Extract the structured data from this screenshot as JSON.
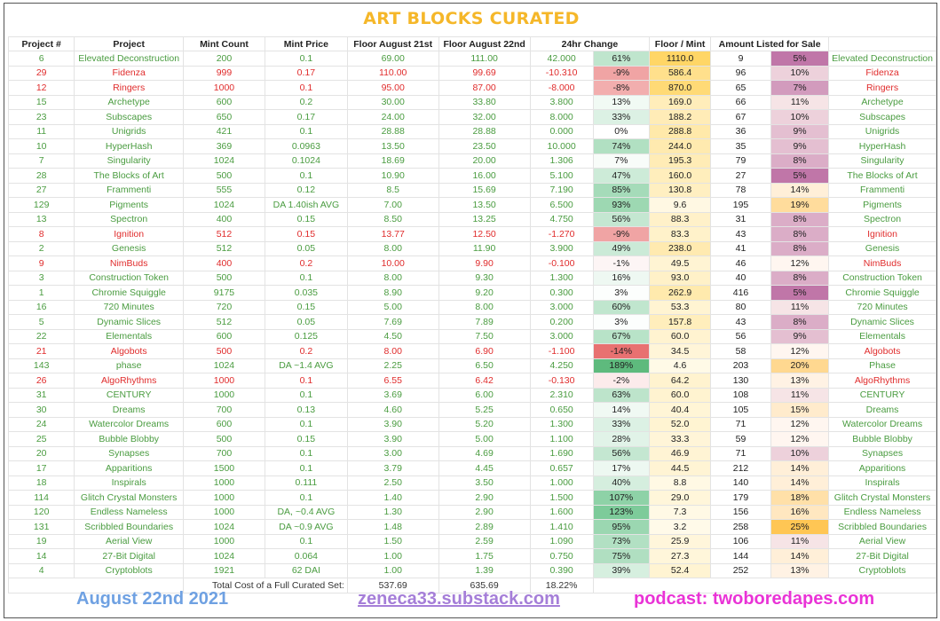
{
  "title": "ART BLOCKS CURATED",
  "headers": [
    "Project #",
    "Project",
    "Mint Count",
    "Mint Price",
    "Floor August 21st",
    "Floor August 22nd",
    "24hr Change",
    "",
    "Floor / Mint",
    "Amount Listed for Sale",
    "",
    ""
  ],
  "rows": [
    {
      "n": "6",
      "p": "Elevated Deconstruction",
      "mc": "200",
      "mp": "0.1",
      "f21": "69.00",
      "f22": "111.00",
      "chg": "42.000",
      "pct": "61%",
      "ratio": "1110.0",
      "listed": "9",
      "listp": "5%",
      "name2": "Elevated Deconstruction",
      "neg": false
    },
    {
      "n": "29",
      "p": "Fidenza",
      "mc": "999",
      "mp": "0.17",
      "f21": "110.00",
      "f22": "99.69",
      "chg": "-10.310",
      "pct": "-9%",
      "ratio": "586.4",
      "listed": "96",
      "listp": "10%",
      "name2": "Fidenza",
      "neg": true
    },
    {
      "n": "12",
      "p": "Ringers",
      "mc": "1000",
      "mp": "0.1",
      "f21": "95.00",
      "f22": "87.00",
      "chg": "-8.000",
      "pct": "-8%",
      "ratio": "870.0",
      "listed": "65",
      "listp": "7%",
      "name2": "Ringers",
      "neg": true
    },
    {
      "n": "15",
      "p": "Archetype",
      "mc": "600",
      "mp": "0.2",
      "f21": "30.00",
      "f22": "33.80",
      "chg": "3.800",
      "pct": "13%",
      "ratio": "169.0",
      "listed": "66",
      "listp": "11%",
      "name2": "Archetype",
      "neg": false
    },
    {
      "n": "23",
      "p": "Subscapes",
      "mc": "650",
      "mp": "0.17",
      "f21": "24.00",
      "f22": "32.00",
      "chg": "8.000",
      "pct": "33%",
      "ratio": "188.2",
      "listed": "67",
      "listp": "10%",
      "name2": "Subscapes",
      "neg": false
    },
    {
      "n": "11",
      "p": "Unigrids",
      "mc": "421",
      "mp": "0.1",
      "f21": "28.88",
      "f22": "28.88",
      "chg": "0.000",
      "pct": "0%",
      "ratio": "288.8",
      "listed": "36",
      "listp": "9%",
      "name2": "Unigrids",
      "neg": false
    },
    {
      "n": "10",
      "p": "HyperHash",
      "mc": "369",
      "mp": "0.0963",
      "f21": "13.50",
      "f22": "23.50",
      "chg": "10.000",
      "pct": "74%",
      "ratio": "244.0",
      "listed": "35",
      "listp": "9%",
      "name2": "HyperHash",
      "neg": false
    },
    {
      "n": "7",
      "p": "Singularity",
      "mc": "1024",
      "mp": "0.1024",
      "f21": "18.69",
      "f22": "20.00",
      "chg": "1.306",
      "pct": "7%",
      "ratio": "195.3",
      "listed": "79",
      "listp": "8%",
      "name2": "Singularity",
      "neg": false
    },
    {
      "n": "28",
      "p": "The Blocks of Art",
      "mc": "500",
      "mp": "0.1",
      "f21": "10.90",
      "f22": "16.00",
      "chg": "5.100",
      "pct": "47%",
      "ratio": "160.0",
      "listed": "27",
      "listp": "5%",
      "name2": "The Blocks of Art",
      "neg": false
    },
    {
      "n": "27",
      "p": "Frammenti",
      "mc": "555",
      "mp": "0.12",
      "f21": "8.5",
      "f22": "15.69",
      "chg": "7.190",
      "pct": "85%",
      "ratio": "130.8",
      "listed": "78",
      "listp": "14%",
      "name2": "Frammenti",
      "neg": false
    },
    {
      "n": "129",
      "p": "Pigments",
      "mc": "1024",
      "mp": "DA 1.40ish AVG",
      "f21": "7.00",
      "f22": "13.50",
      "chg": "6.500",
      "pct": "93%",
      "ratio": "9.6",
      "listed": "195",
      "listp": "19%",
      "name2": "Pigments",
      "neg": false
    },
    {
      "n": "13",
      "p": "Spectron",
      "mc": "400",
      "mp": "0.15",
      "f21": "8.50",
      "f22": "13.25",
      "chg": "4.750",
      "pct": "56%",
      "ratio": "88.3",
      "listed": "31",
      "listp": "8%",
      "name2": "Spectron",
      "neg": false
    },
    {
      "n": "8",
      "p": "Ignition",
      "mc": "512",
      "mp": "0.15",
      "f21": "13.77",
      "f22": "12.50",
      "chg": "-1.270",
      "pct": "-9%",
      "ratio": "83.3",
      "listed": "43",
      "listp": "8%",
      "name2": "Ignition",
      "neg": true
    },
    {
      "n": "2",
      "p": "Genesis",
      "mc": "512",
      "mp": "0.05",
      "f21": "8.00",
      "f22": "11.90",
      "chg": "3.900",
      "pct": "49%",
      "ratio": "238.0",
      "listed": "41",
      "listp": "8%",
      "name2": "Genesis",
      "neg": false
    },
    {
      "n": "9",
      "p": "NimBuds",
      "mc": "400",
      "mp": "0.2",
      "f21": "10.00",
      "f22": "9.90",
      "chg": "-0.100",
      "pct": "-1%",
      "ratio": "49.5",
      "listed": "46",
      "listp": "12%",
      "name2": "NimBuds",
      "neg": true
    },
    {
      "n": "3",
      "p": "Construction Token",
      "mc": "500",
      "mp": "0.1",
      "f21": "8.00",
      "f22": "9.30",
      "chg": "1.300",
      "pct": "16%",
      "ratio": "93.0",
      "listed": "40",
      "listp": "8%",
      "name2": "Construction Token",
      "neg": false
    },
    {
      "n": "1",
      "p": "Chromie Squiggle",
      "mc": "9175",
      "mp": "0.035",
      "f21": "8.90",
      "f22": "9.20",
      "chg": "0.300",
      "pct": "3%",
      "ratio": "262.9",
      "listed": "416",
      "listp": "5%",
      "name2": "Chromie Squiggle",
      "neg": false
    },
    {
      "n": "16",
      "p": "720 Minutes",
      "mc": "720",
      "mp": "0.15",
      "f21": "5.00",
      "f22": "8.00",
      "chg": "3.000",
      "pct": "60%",
      "ratio": "53.3",
      "listed": "80",
      "listp": "11%",
      "name2": "720 Minutes",
      "neg": false
    },
    {
      "n": "5",
      "p": "Dynamic Slices",
      "mc": "512",
      "mp": "0.05",
      "f21": "7.69",
      "f22": "7.89",
      "chg": "0.200",
      "pct": "3%",
      "ratio": "157.8",
      "listed": "43",
      "listp": "8%",
      "name2": "Dynamic Slices",
      "neg": false
    },
    {
      "n": "22",
      "p": "Elementals",
      "mc": "600",
      "mp": "0.125",
      "f21": "4.50",
      "f22": "7.50",
      "chg": "3.000",
      "pct": "67%",
      "ratio": "60.0",
      "listed": "56",
      "listp": "9%",
      "name2": "Elementals",
      "neg": false
    },
    {
      "n": "21",
      "p": "Algobots",
      "mc": "500",
      "mp": "0.2",
      "f21": "8.00",
      "f22": "6.90",
      "chg": "-1.100",
      "pct": "-14%",
      "ratio": "34.5",
      "listed": "58",
      "listp": "12%",
      "name2": "Algobots",
      "neg": true
    },
    {
      "n": "143",
      "p": "phase",
      "mc": "1024",
      "mp": "DA ~1.4 AVG",
      "f21": "2.25",
      "f22": "6.50",
      "chg": "4.250",
      "pct": "189%",
      "ratio": "4.6",
      "listed": "203",
      "listp": "20%",
      "name2": "Phase",
      "neg": false
    },
    {
      "n": "26",
      "p": "AlgoRhythms",
      "mc": "1000",
      "mp": "0.1",
      "f21": "6.55",
      "f22": "6.42",
      "chg": "-0.130",
      "pct": "-2%",
      "ratio": "64.2",
      "listed": "130",
      "listp": "13%",
      "name2": "AlgoRhythms",
      "neg": true
    },
    {
      "n": "31",
      "p": "CENTURY",
      "mc": "1000",
      "mp": "0.1",
      "f21": "3.69",
      "f22": "6.00",
      "chg": "2.310",
      "pct": "63%",
      "ratio": "60.0",
      "listed": "108",
      "listp": "11%",
      "name2": "CENTURY",
      "neg": false
    },
    {
      "n": "30",
      "p": "Dreams",
      "mc": "700",
      "mp": "0.13",
      "f21": "4.60",
      "f22": "5.25",
      "chg": "0.650",
      "pct": "14%",
      "ratio": "40.4",
      "listed": "105",
      "listp": "15%",
      "name2": "Dreams",
      "neg": false
    },
    {
      "n": "24",
      "p": "Watercolor Dreams",
      "mc": "600",
      "mp": "0.1",
      "f21": "3.90",
      "f22": "5.20",
      "chg": "1.300",
      "pct": "33%",
      "ratio": "52.0",
      "listed": "71",
      "listp": "12%",
      "name2": "Watercolor Dreams",
      "neg": false
    },
    {
      "n": "25",
      "p": "Bubble Blobby",
      "mc": "500",
      "mp": "0.15",
      "f21": "3.90",
      "f22": "5.00",
      "chg": "1.100",
      "pct": "28%",
      "ratio": "33.3",
      "listed": "59",
      "listp": "12%",
      "name2": "Bubble Blobby",
      "neg": false
    },
    {
      "n": "20",
      "p": "Synapses",
      "mc": "700",
      "mp": "0.1",
      "f21": "3.00",
      "f22": "4.69",
      "chg": "1.690",
      "pct": "56%",
      "ratio": "46.9",
      "listed": "71",
      "listp": "10%",
      "name2": "Synapses",
      "neg": false
    },
    {
      "n": "17",
      "p": "Apparitions",
      "mc": "1500",
      "mp": "0.1",
      "f21": "3.79",
      "f22": "4.45",
      "chg": "0.657",
      "pct": "17%",
      "ratio": "44.5",
      "listed": "212",
      "listp": "14%",
      "name2": "Apparitions",
      "neg": false
    },
    {
      "n": "18",
      "p": "Inspirals",
      "mc": "1000",
      "mp": "0.111",
      "f21": "2.50",
      "f22": "3.50",
      "chg": "1.000",
      "pct": "40%",
      "ratio": "8.8",
      "listed": "140",
      "listp": "14%",
      "name2": "Inspirals",
      "neg": false
    },
    {
      "n": "114",
      "p": "Glitch Crystal Monsters",
      "mc": "1000",
      "mp": "0.1",
      "f21": "1.40",
      "f22": "2.90",
      "chg": "1.500",
      "pct": "107%",
      "ratio": "29.0",
      "listed": "179",
      "listp": "18%",
      "name2": "Glitch Crystal Monsters",
      "neg": false
    },
    {
      "n": "120",
      "p": "Endless Nameless",
      "mc": "1000",
      "mp": "DA, ~0.4 AVG",
      "f21": "1.30",
      "f22": "2.90",
      "chg": "1.600",
      "pct": "123%",
      "ratio": "7.3",
      "listed": "156",
      "listp": "16%",
      "name2": "Endless Nameless",
      "neg": false
    },
    {
      "n": "131",
      "p": "Scribbled Boundaries",
      "mc": "1024",
      "mp": "DA ~0.9 AVG",
      "f21": "1.48",
      "f22": "2.89",
      "chg": "1.410",
      "pct": "95%",
      "ratio": "3.2",
      "listed": "258",
      "listp": "25%",
      "name2": "Scribbled Boundaries",
      "neg": false
    },
    {
      "n": "19",
      "p": "Aerial View",
      "mc": "1000",
      "mp": "0.1",
      "f21": "1.50",
      "f22": "2.59",
      "chg": "1.090",
      "pct": "73%",
      "ratio": "25.9",
      "listed": "106",
      "listp": "11%",
      "name2": "Aerial View",
      "neg": false
    },
    {
      "n": "14",
      "p": "27-Bit Digital",
      "mc": "1024",
      "mp": "0.064",
      "f21": "1.00",
      "f22": "1.75",
      "chg": "0.750",
      "pct": "75%",
      "ratio": "27.3",
      "listed": "144",
      "listp": "14%",
      "name2": "27-Bit Digital",
      "neg": false
    },
    {
      "n": "4",
      "p": "Cryptoblots",
      "mc": "1921",
      "mp": "62 DAI",
      "f21": "1.00",
      "f22": "1.39",
      "chg": "0.390",
      "pct": "39%",
      "ratio": "52.4",
      "listed": "252",
      "listp": "13%",
      "name2": "Cryptoblots",
      "neg": false
    }
  ],
  "total": {
    "label": "Total Cost of a Full Curated Set:",
    "f21": "537.69",
    "f22": "635.69",
    "pct": "18.22%"
  },
  "footer": {
    "date": "August 22nd 2021",
    "substack": "zeneca33.substack.com",
    "podcast": "podcast: twoboredapes.com"
  },
  "colors": {
    "title": "#f5b729",
    "positive": "#4a9c40",
    "negative": "#e02c2c",
    "date": "#6fa1e2",
    "substack": "#a57ed8",
    "podcast": "#e933d6"
  }
}
